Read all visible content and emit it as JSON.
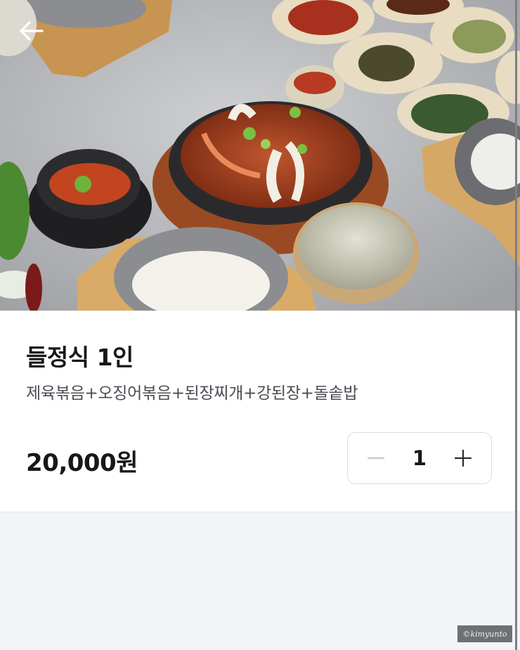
{
  "header": {
    "back_icon": "arrow-left-icon",
    "hero_image": "food-photo"
  },
  "product": {
    "name": "들정식 1인",
    "description": "제육볶음+오징어볶음+된장찌개+강된장+돌솥밥",
    "price": "20,000원"
  },
  "quantity": {
    "value": "1",
    "decrease_icon": "minus-icon",
    "increase_icon": "plus-icon"
  },
  "watermark": {
    "text": "©kimyunto"
  },
  "colors": {
    "text_primary": "#16181c",
    "text_secondary": "#4a4d53",
    "border": "#d9dce1",
    "page_background": "#f2f4f8"
  }
}
